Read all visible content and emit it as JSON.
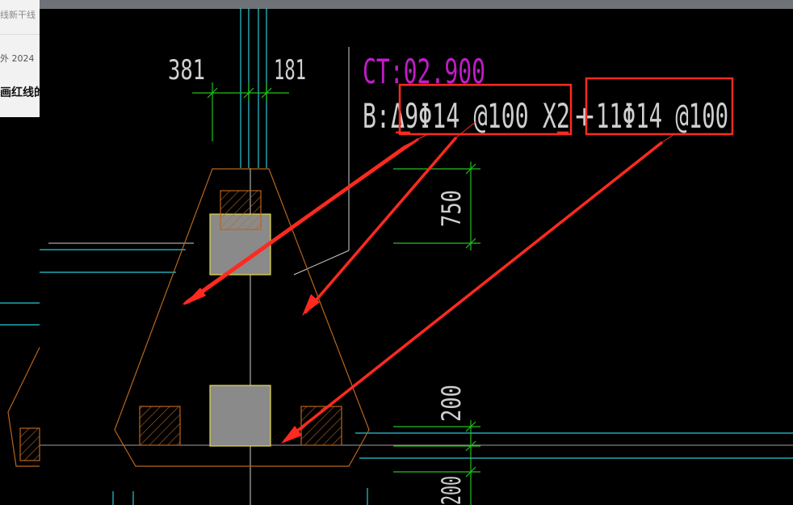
{
  "browser_panel": {
    "line1": "线新干线",
    "line2": "外  2024",
    "line3": "画红线的"
  },
  "drawing": {
    "dim_left": "381",
    "dim_right": "181",
    "ct_label": "CT:02.900",
    "rebar_b_prefix": "B:",
    "rebar_group1": "Δ9Φ14 @100 X2",
    "rebar_plus": "+",
    "rebar_group2": "11Φ14 @100",
    "dim_750": "750",
    "dim_200": "200",
    "dim_bottom": "200"
  },
  "colors": {
    "background": "#000000",
    "outline": "#b8651f",
    "annotation": "#ff2a1f",
    "dimension": "#22c01e",
    "axis": "#27c9d6",
    "magenta": "#c21bc9",
    "column_fill": "#8a8a8a",
    "column_edge": "#e6d94a"
  }
}
